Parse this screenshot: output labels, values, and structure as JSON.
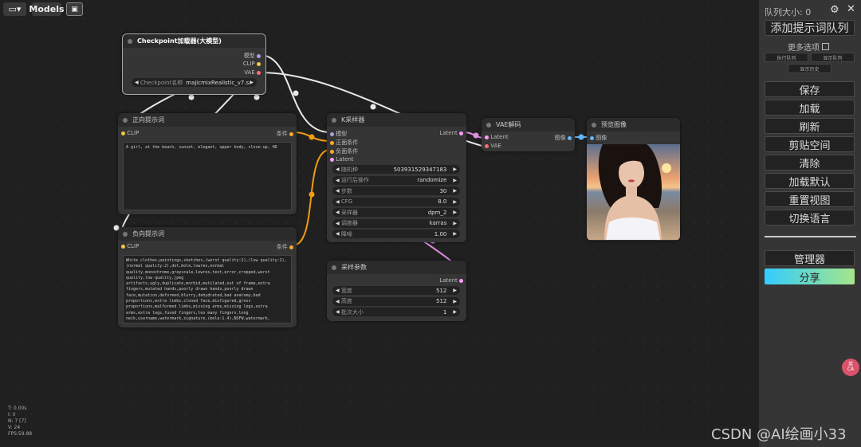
{
  "toolbar": {
    "models_label": "Models"
  },
  "nodes": {
    "checkpoint": {
      "title": "Checkpoint加载器(大模型)",
      "out_model": "模型",
      "out_clip": "CLIP",
      "out_vae": "VAE",
      "ckpt_label": "Checkpoint名称",
      "ckpt_value": "majicmixRealistic_v7.sa..."
    },
    "pos_prompt": {
      "title": "正向提示词",
      "in_clip": "CLIP",
      "out_cond": "条件",
      "text": "A girl, at the beach, sunset, elegant, upper body, close-up, HD"
    },
    "neg_prompt": {
      "title": "负向提示词",
      "in_clip": "CLIP",
      "out_cond": "条件",
      "text": "White clothes,paintings,sketches,(worst quality:2),(low quality:2),(normal quality:2),dot,mole,lowres,normal quality,monochrome,grayscale,lowres,text,error,cropped,worst quality,low quality,jpeg artifacts,ugly,duplicate,morbid,mutilated,out of frame,extra fingers,mutated hands,poorly drawn hands,poorly drawn face,mutation,deformed,blurry,dehydrated,bad anatomy,bad proportions,extra limbs,cloned face,disfigured,gross proportions,malformed limbs,missing arms,missing legs,extra arms,extra legs,fused fingers,too many fingers,long neck,username,watermark,signature,(mole:1.4),NSFW,watermark,"
    },
    "ksampler": {
      "title": "K采样器",
      "in_model": "模型",
      "in_pos": "正面条件",
      "in_neg": "负面条件",
      "in_latent": "Latent",
      "out_latent": "Latent",
      "widgets": [
        {
          "label": "随机种",
          "value": "503931529347183"
        },
        {
          "label": "运行后操作",
          "value": "randomize"
        },
        {
          "label": "步数",
          "value": "30"
        },
        {
          "label": "CFG",
          "value": "8.0"
        },
        {
          "label": "采样器",
          "value": "dpm_2"
        },
        {
          "label": "调度器",
          "value": "karras"
        },
        {
          "label": "降噪",
          "value": "1.00"
        }
      ]
    },
    "vae_decode": {
      "title": "VAE解码",
      "in_latent": "Latent",
      "in_vae": "VAE",
      "out_image": "图像"
    },
    "preview": {
      "title": "预览图像",
      "in_image": "图像"
    },
    "latent": {
      "title": "采样参数",
      "out_latent": "Latent",
      "widgets": [
        {
          "label": "宽度",
          "value": "512"
        },
        {
          "label": "高度",
          "value": "512"
        },
        {
          "label": "批次大小",
          "value": "1"
        }
      ]
    }
  },
  "stats": {
    "t": "T: 0.00s",
    "i": "I: 0",
    "n": "N: 7 [7]",
    "v": "V: 24",
    "fps": "FPS:59.88"
  },
  "side_panel": {
    "queue_size": "队列大小: 0",
    "queue_button": "添加提示词队列",
    "more_options": "更多选项",
    "btn_run_queue": "执行队列",
    "btn_show_queue": "显示队列",
    "btn_show_history": "显示历史",
    "save": "保存",
    "load": "加载",
    "refresh": "刷新",
    "clipspace": "剪贴空间",
    "clear": "清除",
    "load_default": "加载默认",
    "reset_view": "重置视图",
    "switch_lang": "切换语言",
    "manager": "管理器",
    "share": "分享"
  },
  "floating_badge": "英\nCA",
  "watermark": "CSDN @AI绘画小33",
  "colors": {
    "clip": "#f5c842",
    "model": "#b39ddb",
    "vae": "#ff6e6e",
    "conditioning": "#ffa931",
    "latent": "#ff9cf9",
    "image": "#64b5f6",
    "share_from": "#33ccff",
    "share_to": "#a6e68a"
  }
}
